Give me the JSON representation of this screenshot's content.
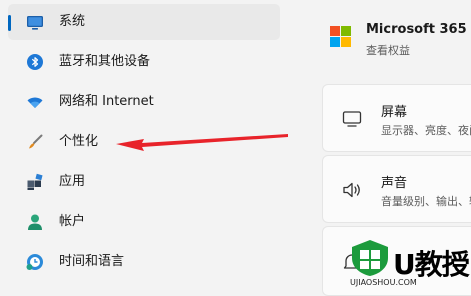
{
  "nav": {
    "items": [
      {
        "label": "系统",
        "icon": "monitor-icon",
        "selected": true
      },
      {
        "label": "蓝牙和其他设备",
        "icon": "bluetooth-icon"
      },
      {
        "label": "网络和 Internet",
        "icon": "wifi-icon"
      },
      {
        "label": "个性化",
        "icon": "brush-icon"
      },
      {
        "label": "应用",
        "icon": "apps-icon"
      },
      {
        "label": "帐户",
        "icon": "person-icon"
      },
      {
        "label": "时间和语言",
        "icon": "clock-globe-icon"
      }
    ]
  },
  "microsoft365": {
    "title": "Microsoft 365",
    "subtitle": "查看权益"
  },
  "cards": [
    {
      "title": "屏幕",
      "subtitle": "显示器、亮度、夜间",
      "icon": "display-icon"
    },
    {
      "title": "声音",
      "subtitle": "音量级别、输出、输入",
      "icon": "speaker-icon"
    }
  ],
  "watermark": {
    "text": "U教授",
    "sub": "UJIAOSHOU.COM"
  },
  "colors": {
    "accent": "#0067c0",
    "arrow": "#e8232a"
  }
}
